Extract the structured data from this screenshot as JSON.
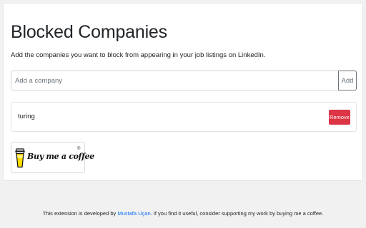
{
  "header": {
    "title": "Blocked Companies",
    "subtitle": "Add the companies you want to block from appearing in your job listings on LinkedIn."
  },
  "form": {
    "placeholder": "Add a company",
    "value": "",
    "add_label": "Add"
  },
  "blocked_list": [
    {
      "name": "turing",
      "remove_label": "Remove"
    }
  ],
  "donate": {
    "label": "Buy me a coffee",
    "registered_mark": "®"
  },
  "footer": {
    "prefix": "This extension is developed by ",
    "author": "Mustafa Uçan",
    "suffix": ". If you find it useful, consider supporting my work by buying me a coffee."
  },
  "colors": {
    "remove": "#dc3545",
    "link": "#0d6efd",
    "add_border": "#6c757d"
  }
}
